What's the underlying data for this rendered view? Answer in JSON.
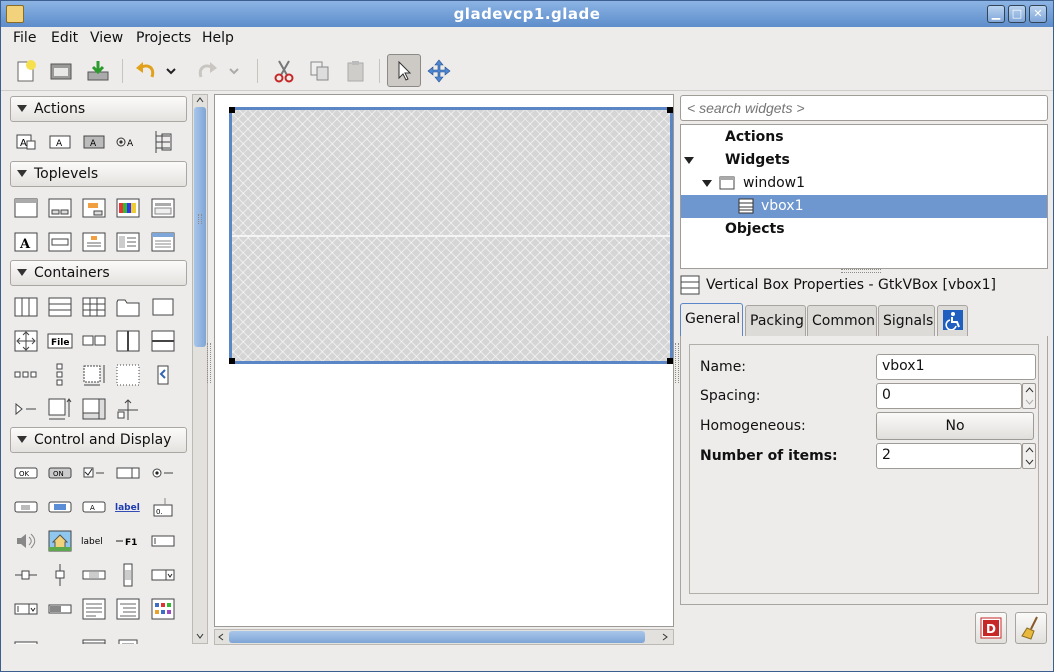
{
  "window": {
    "title": "gladevcp1.glade"
  },
  "menubar": [
    {
      "label": "File"
    },
    {
      "label": "Edit"
    },
    {
      "label": "View"
    },
    {
      "label": "Projects"
    },
    {
      "label": "Help"
    }
  ],
  "palette": {
    "groups": [
      "Actions",
      "Toplevels",
      "Containers",
      "Control and Display"
    ],
    "sample_labels": {
      "file": "File",
      "ok": "OK",
      "on": "ON",
      "label_link": "label",
      "label_plain": "label",
      "f1": "F1",
      "counter": "0."
    }
  },
  "canvas": {
    "rows": 2
  },
  "inspector": {
    "search_placeholder": "< search widgets >",
    "tree": [
      {
        "label": "Actions",
        "bold": true,
        "expanded": false
      },
      {
        "label": "Widgets",
        "bold": true,
        "expanded": true
      },
      {
        "label": "window1",
        "bold": false,
        "expanded": true
      },
      {
        "label": "vbox1",
        "bold": false,
        "selected": true
      },
      {
        "label": "Objects",
        "bold": true
      }
    ]
  },
  "properties": {
    "header": "Vertical Box Properties - GtkVBox [vbox1]",
    "tabs": [
      "General",
      "Packing",
      "Common",
      "Signals"
    ],
    "active_tab": "General",
    "fields": {
      "name_label": "Name:",
      "name_value": "vbox1",
      "spacing_label": "Spacing:",
      "spacing_value": "0",
      "homogeneous_label": "Homogeneous:",
      "homogeneous_value": "No",
      "items_label": "Number of items:",
      "items_value": "2"
    }
  },
  "colors": {
    "selection": "#6f97cf",
    "titlebar": "#5d8dcb",
    "accent": "#5a86c5"
  }
}
